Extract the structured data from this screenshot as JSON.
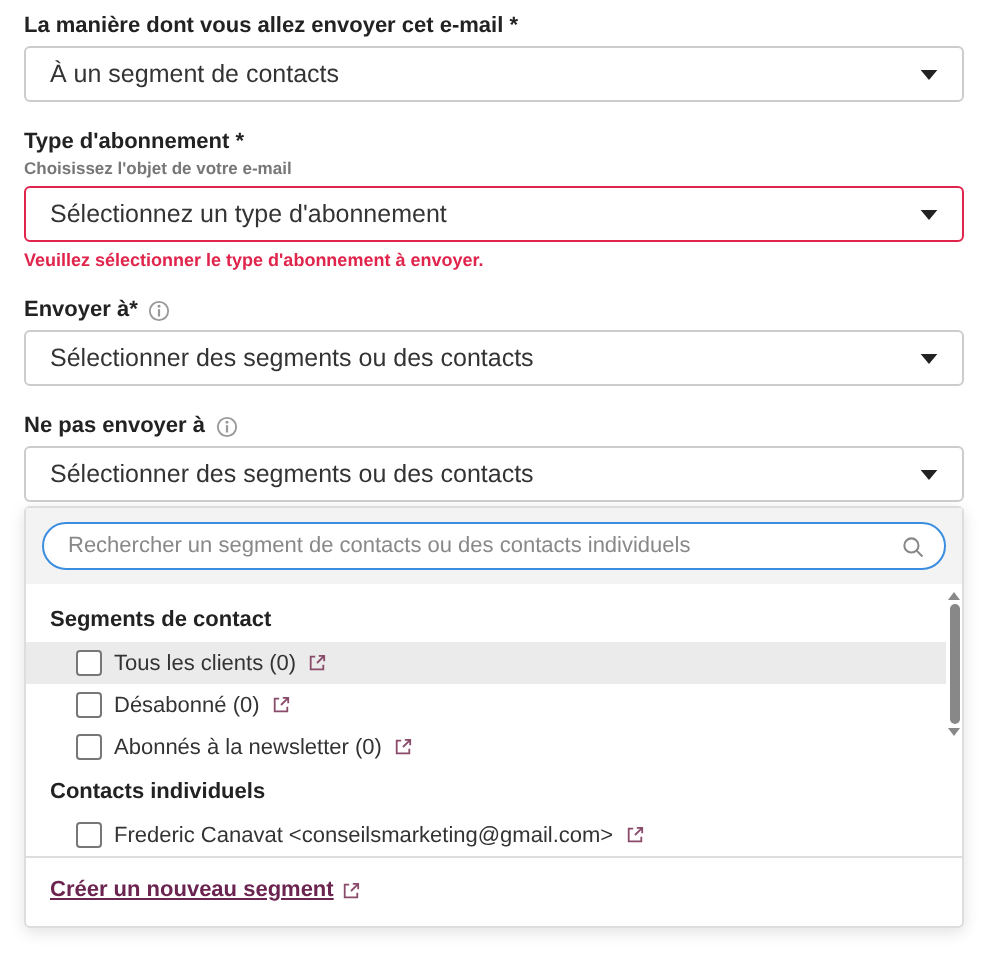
{
  "fields": [
    {
      "label": "La manière dont vous allez envoyer cet e-mail *",
      "info": false,
      "value": "À un segment de contacts",
      "error": false
    },
    {
      "label": "Type d'abonnement *",
      "hint": "Choisissez l'objet de votre e-mail",
      "info": false,
      "value": "Sélectionnez un type d'abonnement",
      "error": true,
      "error_text": "Veuillez sélectionner le type d'abonnement à envoyer."
    },
    {
      "label": "Envoyer à*",
      "info": true,
      "value": "Sélectionner des segments ou des contacts",
      "error": false
    },
    {
      "label": "Ne pas envoyer à",
      "info": true,
      "value": "Sélectionner des segments ou des contacts",
      "error": false
    }
  ],
  "dropdown": {
    "search": {
      "placeholder": "Rechercher un segment de contacts ou des contacts individuels"
    },
    "groups": [
      {
        "title": "Segments de contact",
        "items": [
          {
            "label": "Tous les clients (0)",
            "checked": false,
            "hovered": true
          },
          {
            "label": "Désabonné (0)",
            "checked": false,
            "hovered": false
          },
          {
            "label": "Abonnés à la newsletter (0)",
            "checked": false,
            "hovered": false
          }
        ]
      },
      {
        "title": "Contacts individuels",
        "items": [
          {
            "label": "Frederic Canavat <conseilsmarketing@gmail.com>",
            "checked": false,
            "hovered": false
          }
        ]
      }
    ],
    "footer_link": "Créer un nouveau segment"
  }
}
